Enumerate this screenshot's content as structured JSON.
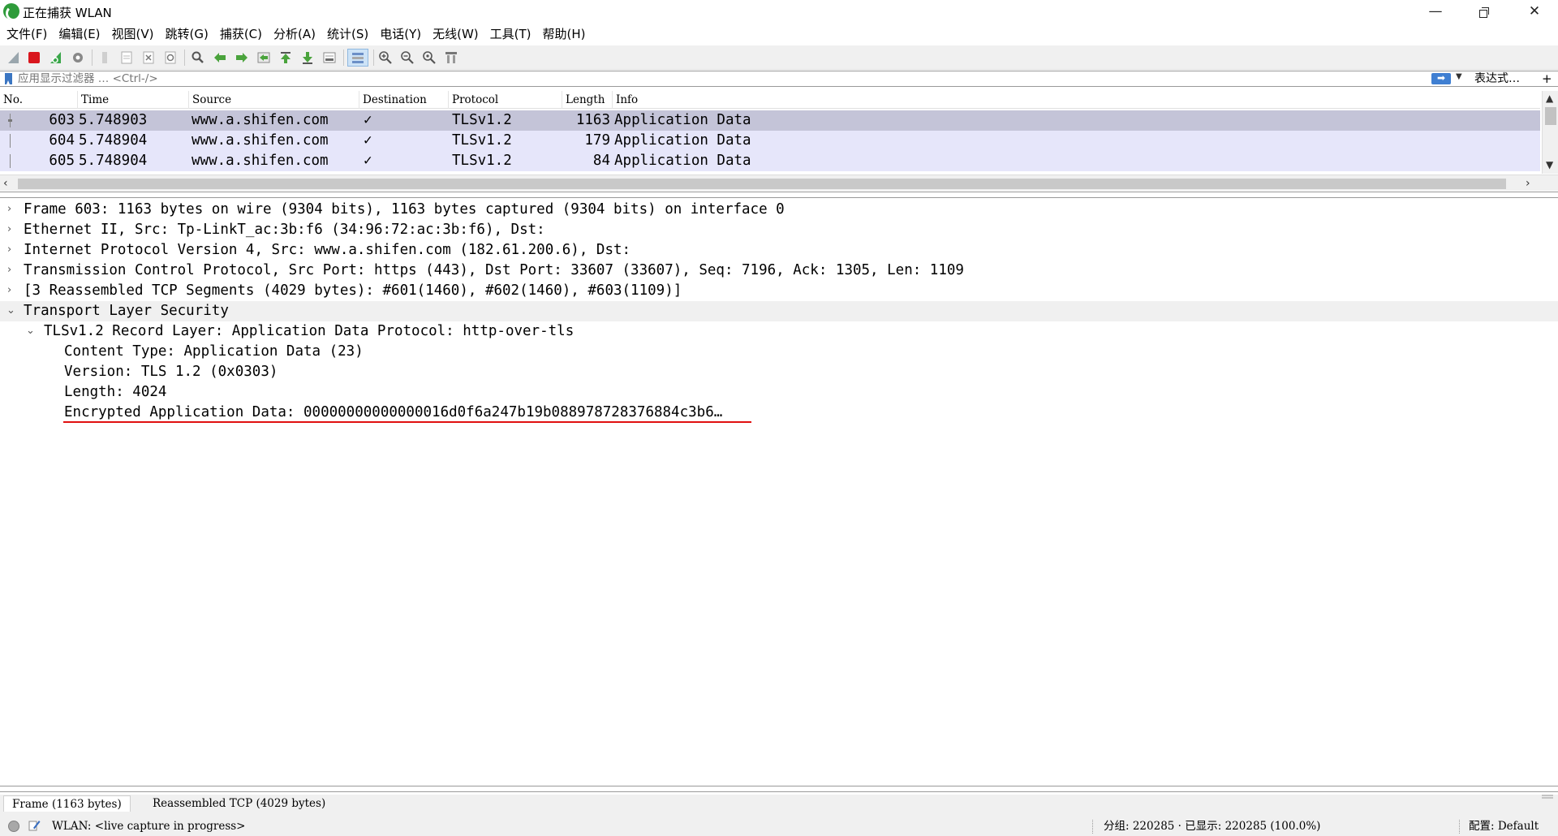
{
  "window": {
    "title": "正在捕获 WLAN",
    "minimize": "—",
    "close": "✕"
  },
  "menu": [
    "文件(F)",
    "编辑(E)",
    "视图(V)",
    "跳转(G)",
    "捕获(C)",
    "分析(A)",
    "统计(S)",
    "电话(Y)",
    "无线(W)",
    "工具(T)",
    "帮助(H)"
  ],
  "toolbar_icons": [
    "shark-fin-start-icon",
    "stop-capture-icon",
    "restart-capture-icon",
    "capture-options-icon",
    "open-file-icon",
    "save-file-icon",
    "close-file-icon",
    "reload-file-icon",
    "find-packet-icon",
    "go-back-icon",
    "go-forward-icon",
    "go-to-packet-icon",
    "go-first-icon",
    "go-last-icon",
    "auto-scroll-icon",
    "colorize-icon",
    "zoom-in-icon",
    "zoom-out-icon",
    "zoom-normal-icon",
    "resize-columns-icon"
  ],
  "filter": {
    "placeholder": "应用显示过滤器 … <Ctrl-/>",
    "apply": "➡",
    "expression": "表达式…",
    "add": "+"
  },
  "packet_list": {
    "columns": [
      "No.",
      "Time",
      "Source",
      "Destination",
      "Protocol",
      "Length",
      "Info"
    ],
    "rows": [
      {
        "no": "603",
        "time": "5.748903",
        "source": "www.a.shifen.com",
        "destination": "✓",
        "protocol": "TLSv1.2",
        "length": "1163",
        "info": "Application Data"
      },
      {
        "no": "604",
        "time": "5.748904",
        "source": "www.a.shifen.com",
        "destination": "✓",
        "protocol": "TLSv1.2",
        "length": "179",
        "info": "Application Data"
      },
      {
        "no": "605",
        "time": "5.748904",
        "source": "www.a.shifen.com",
        "destination": "✓",
        "protocol": "TLSv1.2",
        "length": "84",
        "info": "Application Data"
      }
    ]
  },
  "details": [
    {
      "twisty": "›",
      "text": "Frame 603: 1163 bytes on wire (9304 bits), 1163 bytes captured (9304 bits) on interface 0"
    },
    {
      "twisty": "›",
      "text": "Ethernet II, Src: Tp-LinkT_ac:3b:f6 (34:96:72:ac:3b:f6), Dst:"
    },
    {
      "twisty": "›",
      "text": "Internet Protocol Version 4, Src: www.a.shifen.com (182.61.200.6), Dst:"
    },
    {
      "twisty": "›",
      "text": "Transmission Control Protocol, Src Port: https (443), Dst Port: 33607 (33607), Seq: 7196, Ack: 1305, Len: 1109"
    },
    {
      "twisty": "›",
      "text": "[3 Reassembled TCP Segments (4029 bytes): #601(1460), #602(1460), #603(1109)]"
    },
    {
      "twisty": "⌄",
      "text": "Transport Layer Security"
    },
    {
      "twisty": "⌄",
      "text": "TLSv1.2 Record Layer: Application Data Protocol: http-over-tls"
    },
    {
      "twisty": "",
      "text": "Content Type: Application Data (23)"
    },
    {
      "twisty": "",
      "text": "Version: TLS 1.2 (0x0303)"
    },
    {
      "twisty": "",
      "text": "Length: 4024"
    },
    {
      "twisty": "",
      "text": "Encrypted Application Data: 00000000000000016d0f6a247b19b088978728376884c3b6…"
    }
  ],
  "bytes_tabs": [
    "Frame (1163 bytes)",
    "Reassembled TCP (4029 bytes)"
  ],
  "status": {
    "interface": "WLAN: <live capture in progress>",
    "packets": "分组: 220285 · 已显示: 220285 (100.0%)",
    "profile": "配置: Default"
  },
  "colors": {
    "row_bg": "#e6e6fa",
    "row_selected": "#c4c4d8",
    "underline": "#e01010",
    "stop_red": "#d9161d",
    "shark_green": "#2e9b3a"
  }
}
